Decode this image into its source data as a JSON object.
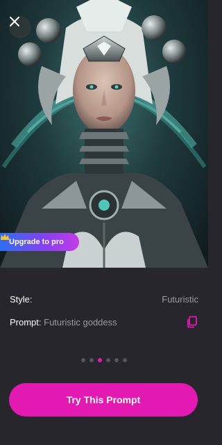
{
  "hero": {
    "image_description": "futuristic-goddess-portrait",
    "close_icon": "close-icon"
  },
  "upgrade": {
    "label": "Upgrade to pro",
    "icon": "crown-icon"
  },
  "details": {
    "style_label": "Style:",
    "style_value": "Futuristic",
    "prompt_label": "Prompt:",
    "prompt_value": "Futuristic goddess",
    "copy_icon": "copy-icon"
  },
  "pagination": {
    "count": 6,
    "active_index": 2
  },
  "cta": {
    "label": "Try This Prompt"
  },
  "colors": {
    "accent": "#e21ab1",
    "background": "#27262d",
    "muted_text": "#9a9aa0"
  }
}
